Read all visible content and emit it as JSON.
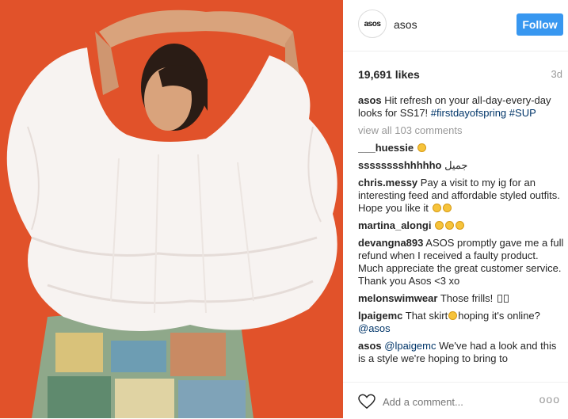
{
  "post": {
    "avatar_text": "asos",
    "username": "asos",
    "follow_label": "Follow",
    "likes": "19,691 likes",
    "time_ago": "3d",
    "caption": {
      "user": "asos",
      "text": "Hit refresh on your all-day-every-day looks for SS17!",
      "hashtag1": "#firstdayofspring",
      "hashtag2": "#SUP"
    },
    "view_all": "view all 103 comments",
    "comments": [
      {
        "user": "___huessie",
        "text": ""
      },
      {
        "user": "sssssssshhhhho",
        "text": "جميل"
      },
      {
        "user": "chris.messy",
        "text": "Pay a visit to my ig for an interesting feed and affordable styled outfits. Hope you like it"
      },
      {
        "user": "martina_alongi",
        "text": ""
      },
      {
        "user": "devangna893",
        "text": "ASOS promptly gave me a full refund when I received a faulty product. Much appreciate the great customer service. Thank you Asos <3 xo"
      },
      {
        "user": "melonswimwear",
        "text": "Those frills!"
      },
      {
        "user": "lpaigemc",
        "text_before": "That skirt",
        "text_after": "hoping it's online?",
        "mention": "@asos"
      },
      {
        "user": "asos",
        "mention": "@lpaigemc",
        "text": " We've had a look and this is a style we're hoping to bring to"
      }
    ],
    "add_comment_placeholder": "Add a comment...",
    "more_label": "ooo"
  },
  "icons": {
    "heart": "heart-icon",
    "emoji": "smiley-emoji-icon",
    "more": "more-options-icon"
  },
  "colors": {
    "follow_button": "#3897f0",
    "photo_background": "#e6582f",
    "hashtag": "#003569",
    "muted_text": "#999999"
  }
}
